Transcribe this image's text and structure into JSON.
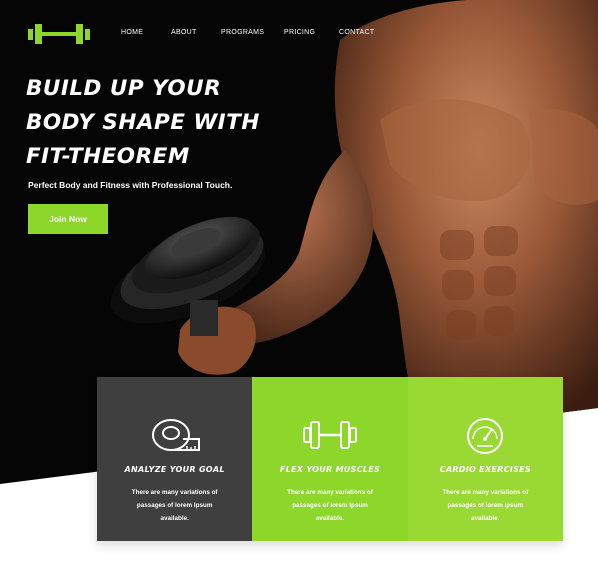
{
  "brand": {
    "logo_icon": "dumbbell-icon",
    "accent_color": "#8cd72a",
    "dark_color": "#3f3f3f"
  },
  "nav": {
    "items": [
      "HOME",
      "ABOUT",
      "PROGRAMS",
      "PRICING",
      "CONTACT"
    ]
  },
  "hero": {
    "headline_lines": [
      "BUILD UP YOUR",
      "BODY SHAPE WITH",
      "FIT-THEOREM"
    ],
    "tagline": "Perfect Body and Fitness with Professional Touch.",
    "cta_label": "Join Now"
  },
  "features": [
    {
      "icon": "measuring-tape-icon",
      "title": "ANALYZE YOUR GOAL",
      "lines": [
        "There are many variations of",
        "passages of lorem Ipsum",
        "available."
      ]
    },
    {
      "icon": "dumbbell-icon",
      "title": "FLEX YOUR MUSCLES",
      "lines": [
        "There are many variations of",
        "passages of lorem Ipsum",
        "available."
      ]
    },
    {
      "icon": "speedometer-icon",
      "title": "CARDIO EXERCISES",
      "lines": [
        "There are many variations of",
        "passages of lorem Ipsum",
        "available."
      ]
    }
  ]
}
